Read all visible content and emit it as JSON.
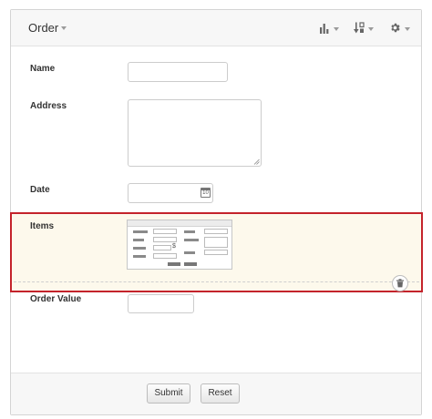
{
  "header": {
    "title": "Order",
    "icons": [
      "bar-chart-icon",
      "sort-icon",
      "gear-icon"
    ]
  },
  "fields": {
    "name": {
      "label": "Name",
      "value": ""
    },
    "address": {
      "label": "Address",
      "value": ""
    },
    "date": {
      "label": "Date",
      "value": "",
      "calendar_icon_text": "10"
    },
    "items": {
      "label": "Items",
      "thumb_symbol": "$"
    },
    "order_value": {
      "label": "Order Value",
      "value": ""
    }
  },
  "footer": {
    "submit_label": "Submit",
    "reset_label": "Reset"
  }
}
